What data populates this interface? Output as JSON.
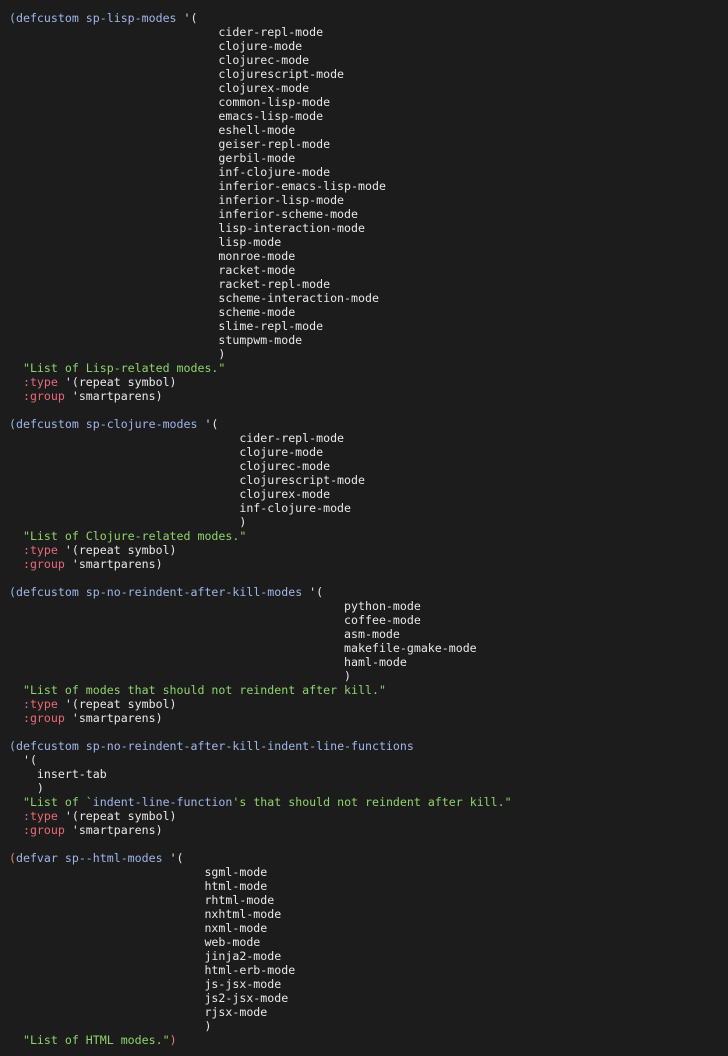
{
  "editor": {
    "lines": [
      {
        "segments": [
          {
            "t": "(",
            "c": "paren"
          },
          {
            "t": "defcustom",
            "c": "kw"
          },
          {
            "t": " sp-lisp-modes ",
            "c": "name"
          },
          {
            "t": "'(",
            "c": "plain"
          }
        ]
      },
      {
        "segments": [
          {
            "t": "                              cider-repl-mode",
            "c": "sym"
          }
        ]
      },
      {
        "segments": [
          {
            "t": "                              clojure-mode",
            "c": "sym"
          }
        ]
      },
      {
        "segments": [
          {
            "t": "                              clojurec-mode",
            "c": "sym"
          }
        ]
      },
      {
        "segments": [
          {
            "t": "                              clojurescript-mode",
            "c": "sym"
          }
        ]
      },
      {
        "segments": [
          {
            "t": "                              clojurex-mode",
            "c": "sym"
          }
        ]
      },
      {
        "segments": [
          {
            "t": "                              common-lisp-mode",
            "c": "sym"
          }
        ]
      },
      {
        "segments": [
          {
            "t": "                              emacs-lisp-mode",
            "c": "sym"
          }
        ]
      },
      {
        "segments": [
          {
            "t": "                              eshell-mode",
            "c": "sym"
          }
        ]
      },
      {
        "segments": [
          {
            "t": "                              geiser-repl-mode",
            "c": "sym"
          }
        ]
      },
      {
        "segments": [
          {
            "t": "                              gerbil-mode",
            "c": "sym"
          }
        ]
      },
      {
        "segments": [
          {
            "t": "                              inf-clojure-mode",
            "c": "sym"
          }
        ]
      },
      {
        "segments": [
          {
            "t": "                              inferior-emacs-lisp-mode",
            "c": "sym"
          }
        ]
      },
      {
        "segments": [
          {
            "t": "                              inferior-lisp-mode",
            "c": "sym"
          }
        ]
      },
      {
        "segments": [
          {
            "t": "                              inferior-scheme-mode",
            "c": "sym"
          }
        ]
      },
      {
        "segments": [
          {
            "t": "                              lisp-interaction-mode",
            "c": "sym"
          }
        ]
      },
      {
        "segments": [
          {
            "t": "                              lisp-mode",
            "c": "sym"
          }
        ]
      },
      {
        "segments": [
          {
            "t": "                              monroe-mode",
            "c": "sym"
          }
        ]
      },
      {
        "segments": [
          {
            "t": "                              racket-mode",
            "c": "sym"
          }
        ]
      },
      {
        "segments": [
          {
            "t": "                              racket-repl-mode",
            "c": "sym"
          }
        ]
      },
      {
        "segments": [
          {
            "t": "                              scheme-interaction-mode",
            "c": "sym"
          }
        ]
      },
      {
        "segments": [
          {
            "t": "                              scheme-mode",
            "c": "sym"
          }
        ]
      },
      {
        "segments": [
          {
            "t": "                              slime-repl-mode",
            "c": "sym"
          }
        ]
      },
      {
        "segments": [
          {
            "t": "                              stumpwm-mode",
            "c": "sym"
          }
        ]
      },
      {
        "segments": [
          {
            "t": "                              )",
            "c": "sym"
          }
        ]
      },
      {
        "segments": [
          {
            "t": "  ",
            "c": "plain"
          },
          {
            "t": "\"List of Lisp-related modes.\"",
            "c": "str"
          }
        ]
      },
      {
        "segments": [
          {
            "t": "  ",
            "c": "plain"
          },
          {
            "t": ":type",
            "c": "key"
          },
          {
            "t": " '(repeat symbol)",
            "c": "plain"
          }
        ]
      },
      {
        "segments": [
          {
            "t": "  ",
            "c": "plain"
          },
          {
            "t": ":group",
            "c": "key"
          },
          {
            "t": " 'smartparens)",
            "c": "plain"
          }
        ]
      },
      {
        "segments": [
          {
            "t": "",
            "c": "plain"
          }
        ]
      },
      {
        "segments": [
          {
            "t": "(",
            "c": "paren"
          },
          {
            "t": "defcustom",
            "c": "kw"
          },
          {
            "t": " sp-clojure-modes ",
            "c": "name"
          },
          {
            "t": "'(",
            "c": "plain"
          }
        ]
      },
      {
        "segments": [
          {
            "t": "                                 cider-repl-mode",
            "c": "sym"
          }
        ]
      },
      {
        "segments": [
          {
            "t": "                                 clojure-mode",
            "c": "sym"
          }
        ]
      },
      {
        "segments": [
          {
            "t": "                                 clojurec-mode",
            "c": "sym"
          }
        ]
      },
      {
        "segments": [
          {
            "t": "                                 clojurescript-mode",
            "c": "sym"
          }
        ]
      },
      {
        "segments": [
          {
            "t": "                                 clojurex-mode",
            "c": "sym"
          }
        ]
      },
      {
        "segments": [
          {
            "t": "                                 inf-clojure-mode",
            "c": "sym"
          }
        ]
      },
      {
        "segments": [
          {
            "t": "                                 )",
            "c": "sym"
          }
        ]
      },
      {
        "segments": [
          {
            "t": "  ",
            "c": "plain"
          },
          {
            "t": "\"List of Clojure-related modes.\"",
            "c": "str"
          }
        ]
      },
      {
        "segments": [
          {
            "t": "  ",
            "c": "plain"
          },
          {
            "t": ":type",
            "c": "key"
          },
          {
            "t": " '(repeat symbol)",
            "c": "plain"
          }
        ]
      },
      {
        "segments": [
          {
            "t": "  ",
            "c": "plain"
          },
          {
            "t": ":group",
            "c": "key"
          },
          {
            "t": " 'smartparens)",
            "c": "plain"
          }
        ]
      },
      {
        "segments": [
          {
            "t": "",
            "c": "plain"
          }
        ]
      },
      {
        "segments": [
          {
            "t": "(",
            "c": "paren"
          },
          {
            "t": "defcustom",
            "c": "kw"
          },
          {
            "t": " sp-no-reindent-after-kill-modes ",
            "c": "name"
          },
          {
            "t": "'(",
            "c": "plain"
          }
        ]
      },
      {
        "segments": [
          {
            "t": "                                                python-mode",
            "c": "sym"
          }
        ]
      },
      {
        "segments": [
          {
            "t": "                                                coffee-mode",
            "c": "sym"
          }
        ]
      },
      {
        "segments": [
          {
            "t": "                                                asm-mode",
            "c": "sym"
          }
        ]
      },
      {
        "segments": [
          {
            "t": "                                                makefile-gmake-mode",
            "c": "sym"
          }
        ]
      },
      {
        "segments": [
          {
            "t": "                                                haml-mode",
            "c": "sym"
          }
        ]
      },
      {
        "segments": [
          {
            "t": "                                                )",
            "c": "sym"
          }
        ]
      },
      {
        "segments": [
          {
            "t": "  ",
            "c": "plain"
          },
          {
            "t": "\"List of modes that should not reindent after kill.\"",
            "c": "str"
          }
        ]
      },
      {
        "segments": [
          {
            "t": "  ",
            "c": "plain"
          },
          {
            "t": ":type",
            "c": "key"
          },
          {
            "t": " '(repeat symbol)",
            "c": "plain"
          }
        ]
      },
      {
        "segments": [
          {
            "t": "  ",
            "c": "plain"
          },
          {
            "t": ":group",
            "c": "key"
          },
          {
            "t": " 'smartparens)",
            "c": "plain"
          }
        ]
      },
      {
        "segments": [
          {
            "t": "",
            "c": "plain"
          }
        ]
      },
      {
        "segments": [
          {
            "t": "(",
            "c": "paren"
          },
          {
            "t": "defcustom",
            "c": "kw"
          },
          {
            "t": " sp-no-reindent-after-kill-indent-line-functions",
            "c": "name"
          }
        ]
      },
      {
        "segments": [
          {
            "t": "  '(",
            "c": "plain"
          }
        ]
      },
      {
        "segments": [
          {
            "t": "    insert-tab",
            "c": "sym"
          }
        ]
      },
      {
        "segments": [
          {
            "t": "    )",
            "c": "sym"
          }
        ]
      },
      {
        "segments": [
          {
            "t": "  ",
            "c": "plain"
          },
          {
            "t": "\"List of `",
            "c": "str"
          },
          {
            "t": "indent-line-function",
            "c": "name"
          },
          {
            "t": "'s that should not reindent after kill.\"",
            "c": "str"
          }
        ]
      },
      {
        "segments": [
          {
            "t": "  ",
            "c": "plain"
          },
          {
            "t": ":type",
            "c": "key"
          },
          {
            "t": " '(repeat symbol)",
            "c": "plain"
          }
        ]
      },
      {
        "segments": [
          {
            "t": "  ",
            "c": "plain"
          },
          {
            "t": ":group",
            "c": "key"
          },
          {
            "t": " 'smartparens)",
            "c": "plain"
          }
        ]
      },
      {
        "segments": [
          {
            "t": "",
            "c": "plain"
          }
        ]
      },
      {
        "segments": [
          {
            "t": "(",
            "c": "paren-warm"
          },
          {
            "t": "defvar",
            "c": "kw"
          },
          {
            "t": " sp--html-modes ",
            "c": "name"
          },
          {
            "t": "'(",
            "c": "plain"
          }
        ]
      },
      {
        "segments": [
          {
            "t": "                            sgml-mode",
            "c": "sym"
          }
        ]
      },
      {
        "segments": [
          {
            "t": "                            html-mode",
            "c": "sym"
          }
        ]
      },
      {
        "segments": [
          {
            "t": "                            rhtml-mode",
            "c": "sym"
          }
        ]
      },
      {
        "segments": [
          {
            "t": "                            nxhtml-mode",
            "c": "sym"
          }
        ]
      },
      {
        "segments": [
          {
            "t": "                            nxml-mode",
            "c": "sym"
          }
        ]
      },
      {
        "segments": [
          {
            "t": "                            web-mode",
            "c": "sym"
          }
        ]
      },
      {
        "segments": [
          {
            "t": "                            jinja2-mode",
            "c": "sym"
          }
        ]
      },
      {
        "segments": [
          {
            "t": "                            html-erb-mode",
            "c": "sym"
          }
        ]
      },
      {
        "segments": [
          {
            "t": "                            js-jsx-mode",
            "c": "sym"
          }
        ]
      },
      {
        "segments": [
          {
            "t": "                            js2-jsx-mode",
            "c": "sym"
          }
        ]
      },
      {
        "segments": [
          {
            "t": "                            rjsx-mode",
            "c": "sym"
          }
        ]
      },
      {
        "segments": [
          {
            "t": "                            )",
            "c": "sym"
          }
        ]
      },
      {
        "segments": [
          {
            "t": "  ",
            "c": "plain"
          },
          {
            "t": "\"List of HTML modes.\"",
            "c": "str"
          },
          {
            "t": ")",
            "c": "paren-warm"
          }
        ]
      }
    ]
  }
}
